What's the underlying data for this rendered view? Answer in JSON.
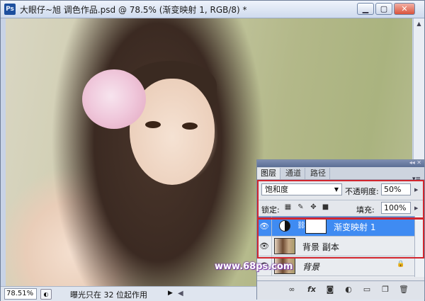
{
  "window": {
    "title": "大眼仔~旭 调色作品.psd @ 78.5% (渐变映射 1, RGB/8) *",
    "app_icon": "Ps",
    "minimize_icon": "minimize-icon",
    "maximize_icon": "maximize-icon",
    "close_icon": "close-icon"
  },
  "statusbar": {
    "zoom": "78.51%",
    "message": "曝光只在 32 位起作用"
  },
  "layers_panel": {
    "tabs": [
      {
        "label": "图层",
        "active": true
      },
      {
        "label": "通道",
        "active": false
      },
      {
        "label": "路径",
        "active": false
      }
    ],
    "blend_mode": "饱和度",
    "opacity_label": "不透明度:",
    "opacity_value": "50%",
    "lock_label": "锁定:",
    "fill_label": "填充:",
    "fill_value": "100%",
    "layers": [
      {
        "name": "渐变映射 1",
        "selected": true,
        "visible": true,
        "type": "adjustment"
      },
      {
        "name": "背景 副本",
        "selected": false,
        "visible": true,
        "type": "pixel"
      },
      {
        "name": "背景",
        "selected": false,
        "visible": true,
        "type": "background",
        "locked": true
      }
    ],
    "bottom_icons": [
      "link-layers-icon",
      "fx-icon",
      "add-mask-icon",
      "adjustment-layer-icon",
      "new-group-icon",
      "new-layer-icon",
      "trash-icon"
    ]
  },
  "watermark": "www.68ps.com",
  "colors": {
    "selection": "#3f8bf2",
    "highlight_border": "#d2262e",
    "watermark_outline": "#7a3ca8"
  }
}
